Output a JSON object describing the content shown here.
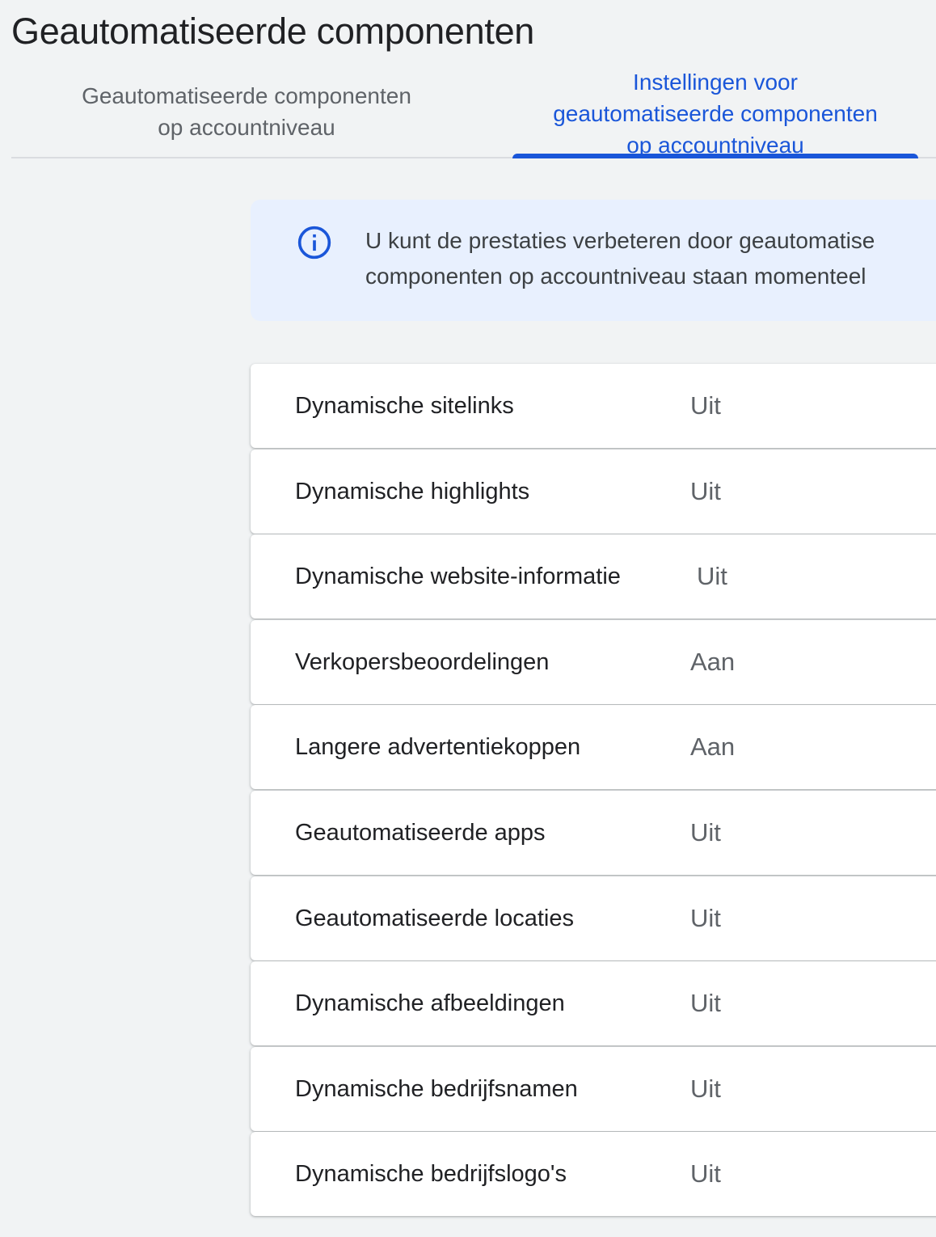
{
  "page": {
    "title": "Geautomatiseerde componenten"
  },
  "tabs": [
    {
      "line1": "Geautomatiseerde componenten",
      "line2": "op accountniveau",
      "selected": false
    },
    {
      "line1": "Instellingen voor",
      "line2": "geautomatiseerde componenten",
      "line3": "op accountniveau",
      "selected": true
    }
  ],
  "colors": {
    "accent": "#1a56d9",
    "banner_bg": "#e8f0fe",
    "page_bg": "#f1f3f4"
  },
  "banner": {
    "icon": "info-icon",
    "line1": "U kunt de prestaties verbeteren door geautomatise",
    "line2": "componenten op accountniveau staan momenteel"
  },
  "settings": [
    {
      "name": "Dynamische sitelinks",
      "status": "Uit"
    },
    {
      "name": "Dynamische highlights",
      "status": "Uit"
    },
    {
      "name": "Dynamische website-informatie",
      "status": "Uit"
    },
    {
      "name": "Verkopersbeoordelingen",
      "status": "Aan"
    },
    {
      "name": "Langere advertentiekoppen",
      "status": "Aan"
    },
    {
      "name": "Geautomatiseerde apps",
      "status": "Uit"
    },
    {
      "name": "Geautomatiseerde locaties",
      "status": "Uit"
    },
    {
      "name": "Dynamische afbeeldingen",
      "status": "Uit"
    },
    {
      "name": "Dynamische bedrijfsnamen",
      "status": "Uit"
    },
    {
      "name": "Dynamische bedrijfslogo's",
      "status": "Uit"
    }
  ]
}
